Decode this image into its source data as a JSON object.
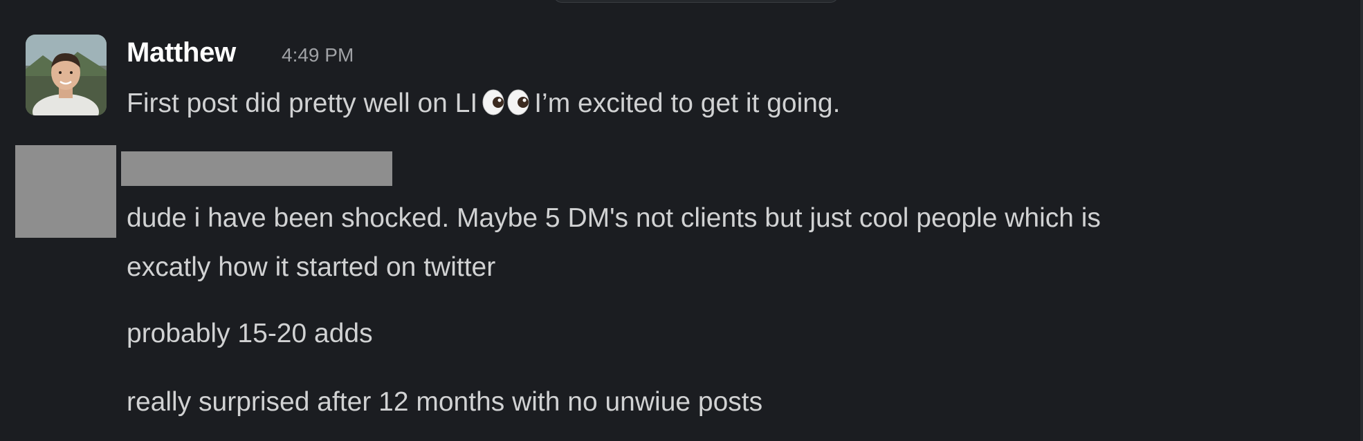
{
  "messages": [
    {
      "author": "Matthew",
      "timestamp": "4:49 PM",
      "text_before_emoji": "First post did pretty well on LI",
      "emoji": "eyes-emoji",
      "text_after_emoji": "I’m excited to get it going."
    },
    {
      "author_redacted": true,
      "lines": [
        "dude i have been shocked. Maybe 5 DM's not clients but just cool people which is",
        "excatly how it started on twitter",
        "probably 15-20 adds",
        "really surprised after 12 months with no unwiue posts"
      ]
    }
  ],
  "colors": {
    "background": "#1b1d21",
    "author_text": "#ffffff",
    "message_text": "#d1d2d3",
    "timestamp_text": "#a0a2a6",
    "redaction": "#8e8e8e"
  }
}
